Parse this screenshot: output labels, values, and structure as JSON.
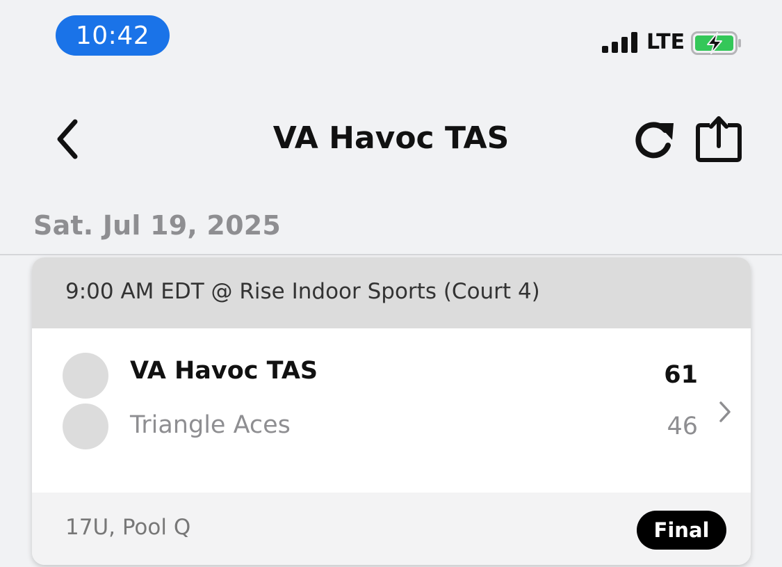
{
  "status_bar": {
    "time": "10:42",
    "network": "LTE",
    "icons": [
      "signal-icon",
      "battery-charging-icon"
    ]
  },
  "nav": {
    "title": "VA Havoc TAS",
    "icons": [
      "chevron-left-icon",
      "refresh-icon",
      "share-icon"
    ]
  },
  "schedule": {
    "date": "Sat. Jul 19, 2025",
    "games": [
      {
        "header": "9:00 AM EDT @ Rise Indoor Sports (Court 4)",
        "teams": [
          {
            "name": "VA Havoc TAS",
            "score": "61",
            "winner": true
          },
          {
            "name": "Triangle Aces",
            "score": "46",
            "winner": false
          }
        ],
        "division": "17U, Pool Q",
        "status": "Final"
      }
    ]
  },
  "colors": {
    "accent": "#1a73e8",
    "battery_green": "#34c759",
    "muted_text": "#8e8e91",
    "badge_bg": "#000000"
  }
}
